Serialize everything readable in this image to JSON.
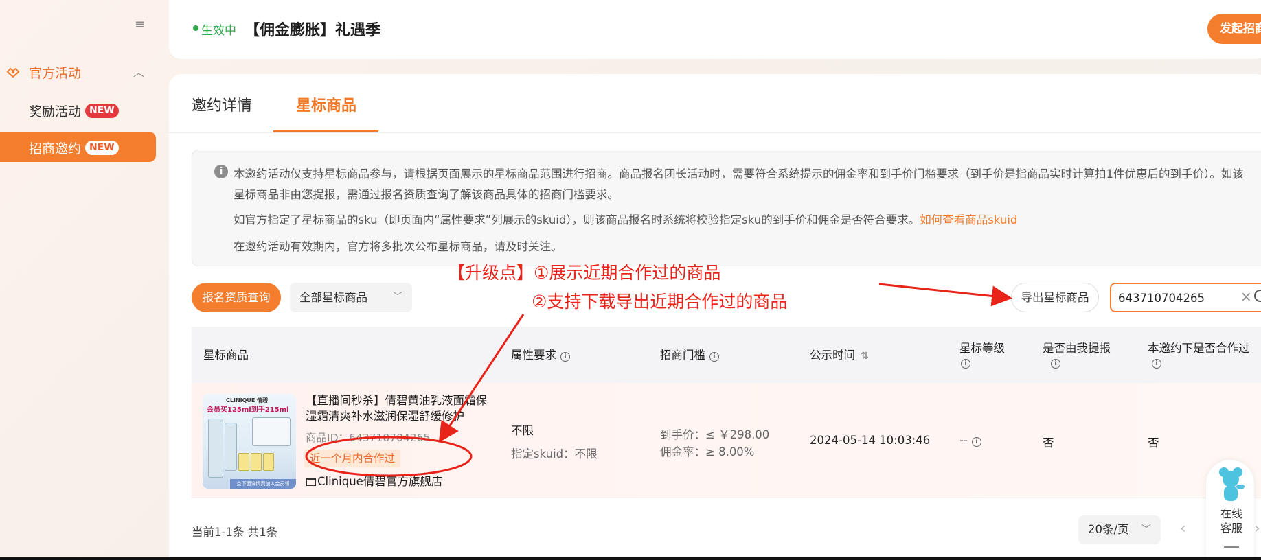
{
  "sidebar": {
    "group_label": "官方活动",
    "items": [
      {
        "label": "奖励活动",
        "badge": "NEW"
      },
      {
        "label": "招商邀约",
        "badge": "NEW"
      }
    ]
  },
  "header": {
    "status": "生效中",
    "title": "【佣金膨胀】礼遇季",
    "launch_button": "发起招商"
  },
  "tabs": [
    "邀约详情",
    "星标商品"
  ],
  "notice": {
    "line1": "本邀约活动仅支持星标商品参与，请根据页面展示的星标商品范围进行招商。商品报名团长活动时，需要符合系统提示的佣金率和到手价门槛要求（到手价是指商品实时计算拍1件优惠后的到手价）。如该",
    "line2": "星标商品非由您提报，需通过报名资质查询了解该商品具体的招商门槛要求。",
    "line3_prefix": "如官方指定了星标商品的sku（即页面内“属性要求”列展示的skuid），则该商品报名时系统将校验指定sku的到手价和佣金是否符合要求。",
    "line3_link": "如何查看商品skuid",
    "line4": "在邀约活动有效期内，官方将多批次公布星标商品，请及时关注。"
  },
  "annotation": {
    "line1": "【升级点】①展示近期合作过的商品",
    "line2": "②支持下载导出近期合作过的商品"
  },
  "filters": {
    "query_button": "报名资质查询",
    "select_value": "全部星标商品",
    "export_button": "导出星标商品",
    "search_value": "643710704265"
  },
  "table": {
    "headers": {
      "product": "星标商品",
      "attr": "属性要求",
      "threshold": "招商门槛",
      "time": "公示时间",
      "level": "星标等级",
      "self": "是否由我提报",
      "coop": "本邀约下是否合作过"
    },
    "rows": [
      {
        "image_logo": "CLINIQUE 倩碧",
        "image_promo": "会员买125ml到手215ml",
        "image_bar": "点下面详情页加入会员领",
        "title": "【直播间秒杀】倩碧黄油乳液面霜保湿霜清爽补水滋润保湿舒缓修护",
        "product_id": "商品ID：643710704265",
        "coop_tag": "近一个月内合作过",
        "shop": "Clinique倩碧官方旗舰店",
        "attr": "不限",
        "attr_sku": "指定skuid：不限",
        "price": "到手价：≤ ￥298.00",
        "rate": "佣金率：≥ 8.00%",
        "time": "2024-05-14 10:03:46",
        "level": "--",
        "self": "否",
        "coop": "否"
      }
    ]
  },
  "pager": {
    "summary": "当前1-1条 共1条",
    "page_size": "20条/页"
  },
  "customer_service": "在线客服",
  "colors": {
    "accent": "#f57e2e",
    "annotation": "#e8231a",
    "status_green": "#2fa84b"
  }
}
